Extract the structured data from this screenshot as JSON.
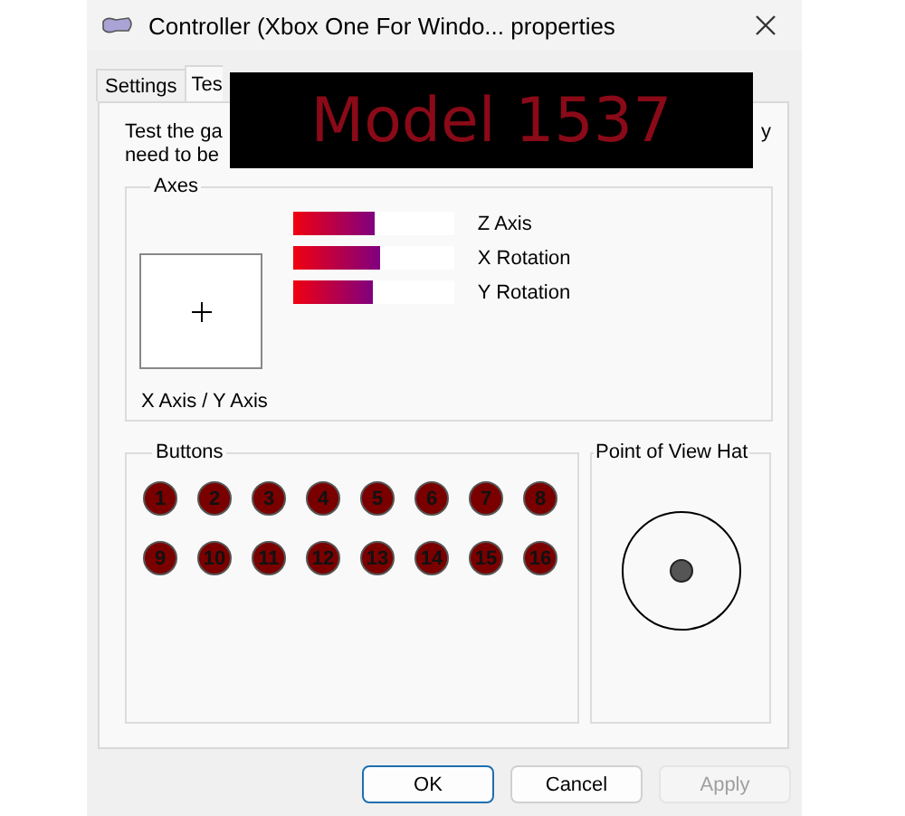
{
  "window": {
    "title": "Controller (Xbox One For Windo... properties"
  },
  "tabs": [
    {
      "label": "Settings",
      "selected": false
    },
    {
      "label": "Tes",
      "selected": true
    }
  ],
  "overlay": {
    "text": "Model 1537"
  },
  "intro": {
    "line_1_start": "Test the ga",
    "line_1_end": "y",
    "line_2": "need to be"
  },
  "axes": {
    "title": "Axes",
    "crosshair_label": "X Axis / Y Axis",
    "bars": [
      {
        "name": "Z Axis",
        "level": 0.51
      },
      {
        "name": "X Rotation",
        "level": 0.54
      },
      {
        "name": "Y Rotation",
        "level": 0.5
      }
    ]
  },
  "buttons_group": {
    "title": "Buttons",
    "buttons": [
      "1",
      "2",
      "3",
      "4",
      "5",
      "6",
      "7",
      "8",
      "9",
      "10",
      "11",
      "12",
      "13",
      "14",
      "15",
      "16"
    ]
  },
  "pov": {
    "title": "Point of View Hat"
  },
  "actions": [
    {
      "label": "OK",
      "kind": "default"
    },
    {
      "label": "Cancel",
      "kind": "normal"
    },
    {
      "label": "Apply",
      "kind": "disabled"
    }
  ]
}
